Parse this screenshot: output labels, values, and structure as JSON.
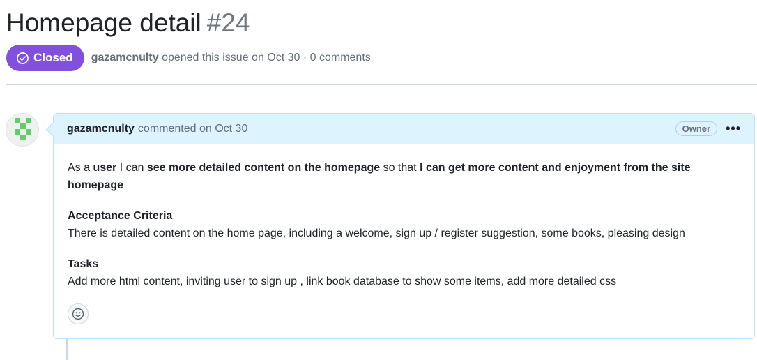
{
  "issue": {
    "title": "Homepage detail",
    "number": "#24",
    "state": "Closed",
    "author": "gazamcnulty",
    "opened_text": "opened this issue on Oct 30 · 0 comments",
    "state_color": "#8250df"
  },
  "comment": {
    "author": "gazamcnulty",
    "commented_text": "commented on Oct 30",
    "role_badge": "Owner",
    "menu_icon": "kebab-horizontal-icon",
    "body": {
      "story": {
        "t1": "As a ",
        "b1": "user",
        "t2": " I can ",
        "b2": "see more detailed content on the homepage",
        "t3": " so that ",
        "b3": "I can get more content and enjoyment from the site homepage"
      },
      "acceptance_heading": "Acceptance Criteria",
      "acceptance_text": "There is detailed content on the home page, including a welcome, sign up / register suggestion, some books, pleasing design",
      "tasks_heading": "Tasks",
      "tasks_text": "Add more html content, inviting user to sign up , link book database to show some items, add more detailed css"
    },
    "reaction_icon": "smiley-icon"
  },
  "colors": {
    "header_bg": "#ddf4ff",
    "header_border": "#b6e3ff",
    "avatar_green": "#5fce6b"
  }
}
